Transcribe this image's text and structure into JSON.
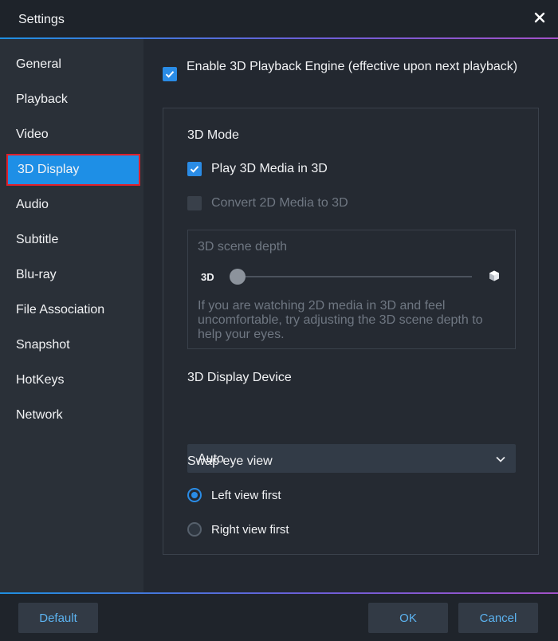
{
  "window": {
    "title": "Settings"
  },
  "sidebar": {
    "items": [
      {
        "label": "General"
      },
      {
        "label": "Playback"
      },
      {
        "label": "Video"
      },
      {
        "label": "3D Display",
        "active": true
      },
      {
        "label": "Audio"
      },
      {
        "label": "Subtitle"
      },
      {
        "label": "Blu-ray"
      },
      {
        "label": "File Association"
      },
      {
        "label": "Snapshot"
      },
      {
        "label": "HotKeys"
      },
      {
        "label": "Network"
      }
    ]
  },
  "main": {
    "enable_engine": {
      "label": "Enable 3D Playback Engine (effective upon next playback)",
      "checked": true
    },
    "mode": {
      "heading": "3D Mode",
      "play_3d": {
        "label": "Play 3D Media in 3D",
        "checked": true
      },
      "convert_2d": {
        "label": "Convert 2D Media to 3D",
        "checked": false,
        "disabled": true
      }
    },
    "depth": {
      "heading": "3D scene depth",
      "slider_left_label": "3D",
      "slider_value": 0,
      "help": "If you are watching 2D media in 3D and feel uncomfortable, try adjusting the 3D scene depth to help your eyes."
    },
    "device": {
      "heading": "3D Display Device",
      "selected": "Auto"
    },
    "swap": {
      "heading": "Swap eye view",
      "left": {
        "label": "Left view first",
        "selected": true
      },
      "right": {
        "label": "Right view first",
        "selected": false
      }
    }
  },
  "footer": {
    "default_label": "Default",
    "ok_label": "OK",
    "cancel_label": "Cancel"
  },
  "colors": {
    "accent": "#2a8ce6",
    "highlight_border": "#e0202a",
    "background": "#232830"
  }
}
